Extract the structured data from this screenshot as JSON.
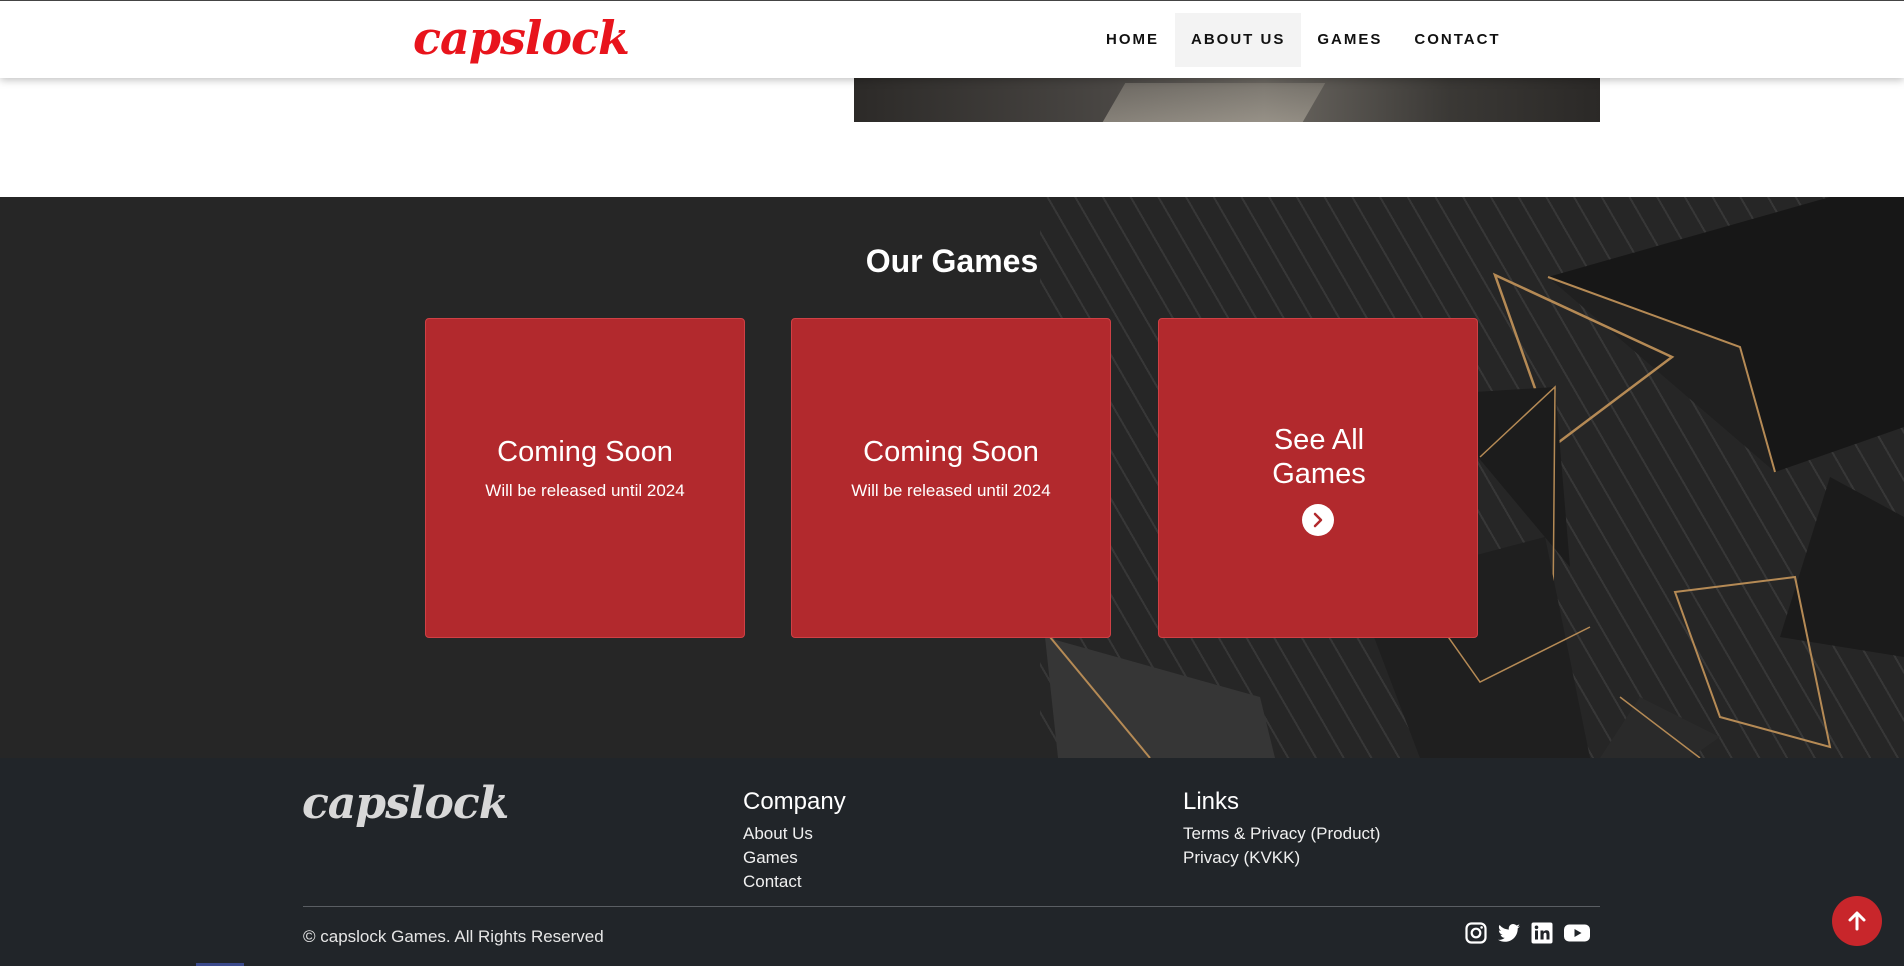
{
  "header": {
    "logo": "capslock",
    "nav": [
      {
        "label": "HOME"
      },
      {
        "label": "ABOUT US"
      },
      {
        "label": "GAMES"
      },
      {
        "label": "CONTACT"
      }
    ]
  },
  "games": {
    "title": "Our Games",
    "cards": [
      {
        "title": "Coming Soon",
        "subtitle": "Will be released until 2024"
      },
      {
        "title": "Coming Soon",
        "subtitle": "Will be released until 2024"
      }
    ],
    "see_all": {
      "line1": "See All",
      "line2": "Games",
      "icon": "chevron-right-icon"
    }
  },
  "footer": {
    "logo": "capslock",
    "company": {
      "heading": "Company",
      "links": [
        "About Us",
        "Games",
        "Contact"
      ]
    },
    "links": {
      "heading": "Links",
      "items": [
        "Terms & Privacy (Product)",
        "Privacy (KVKK)"
      ]
    },
    "copyright": "© capslock Games. All Rights Reserved",
    "socials": [
      "instagram-icon",
      "twitter-icon",
      "linkedin-icon",
      "youtube-icon"
    ]
  },
  "colors": {
    "brand_red": "#e8141c",
    "card_red": "#b2292d",
    "section_dark": "#262626",
    "footer_dark": "#212529"
  }
}
